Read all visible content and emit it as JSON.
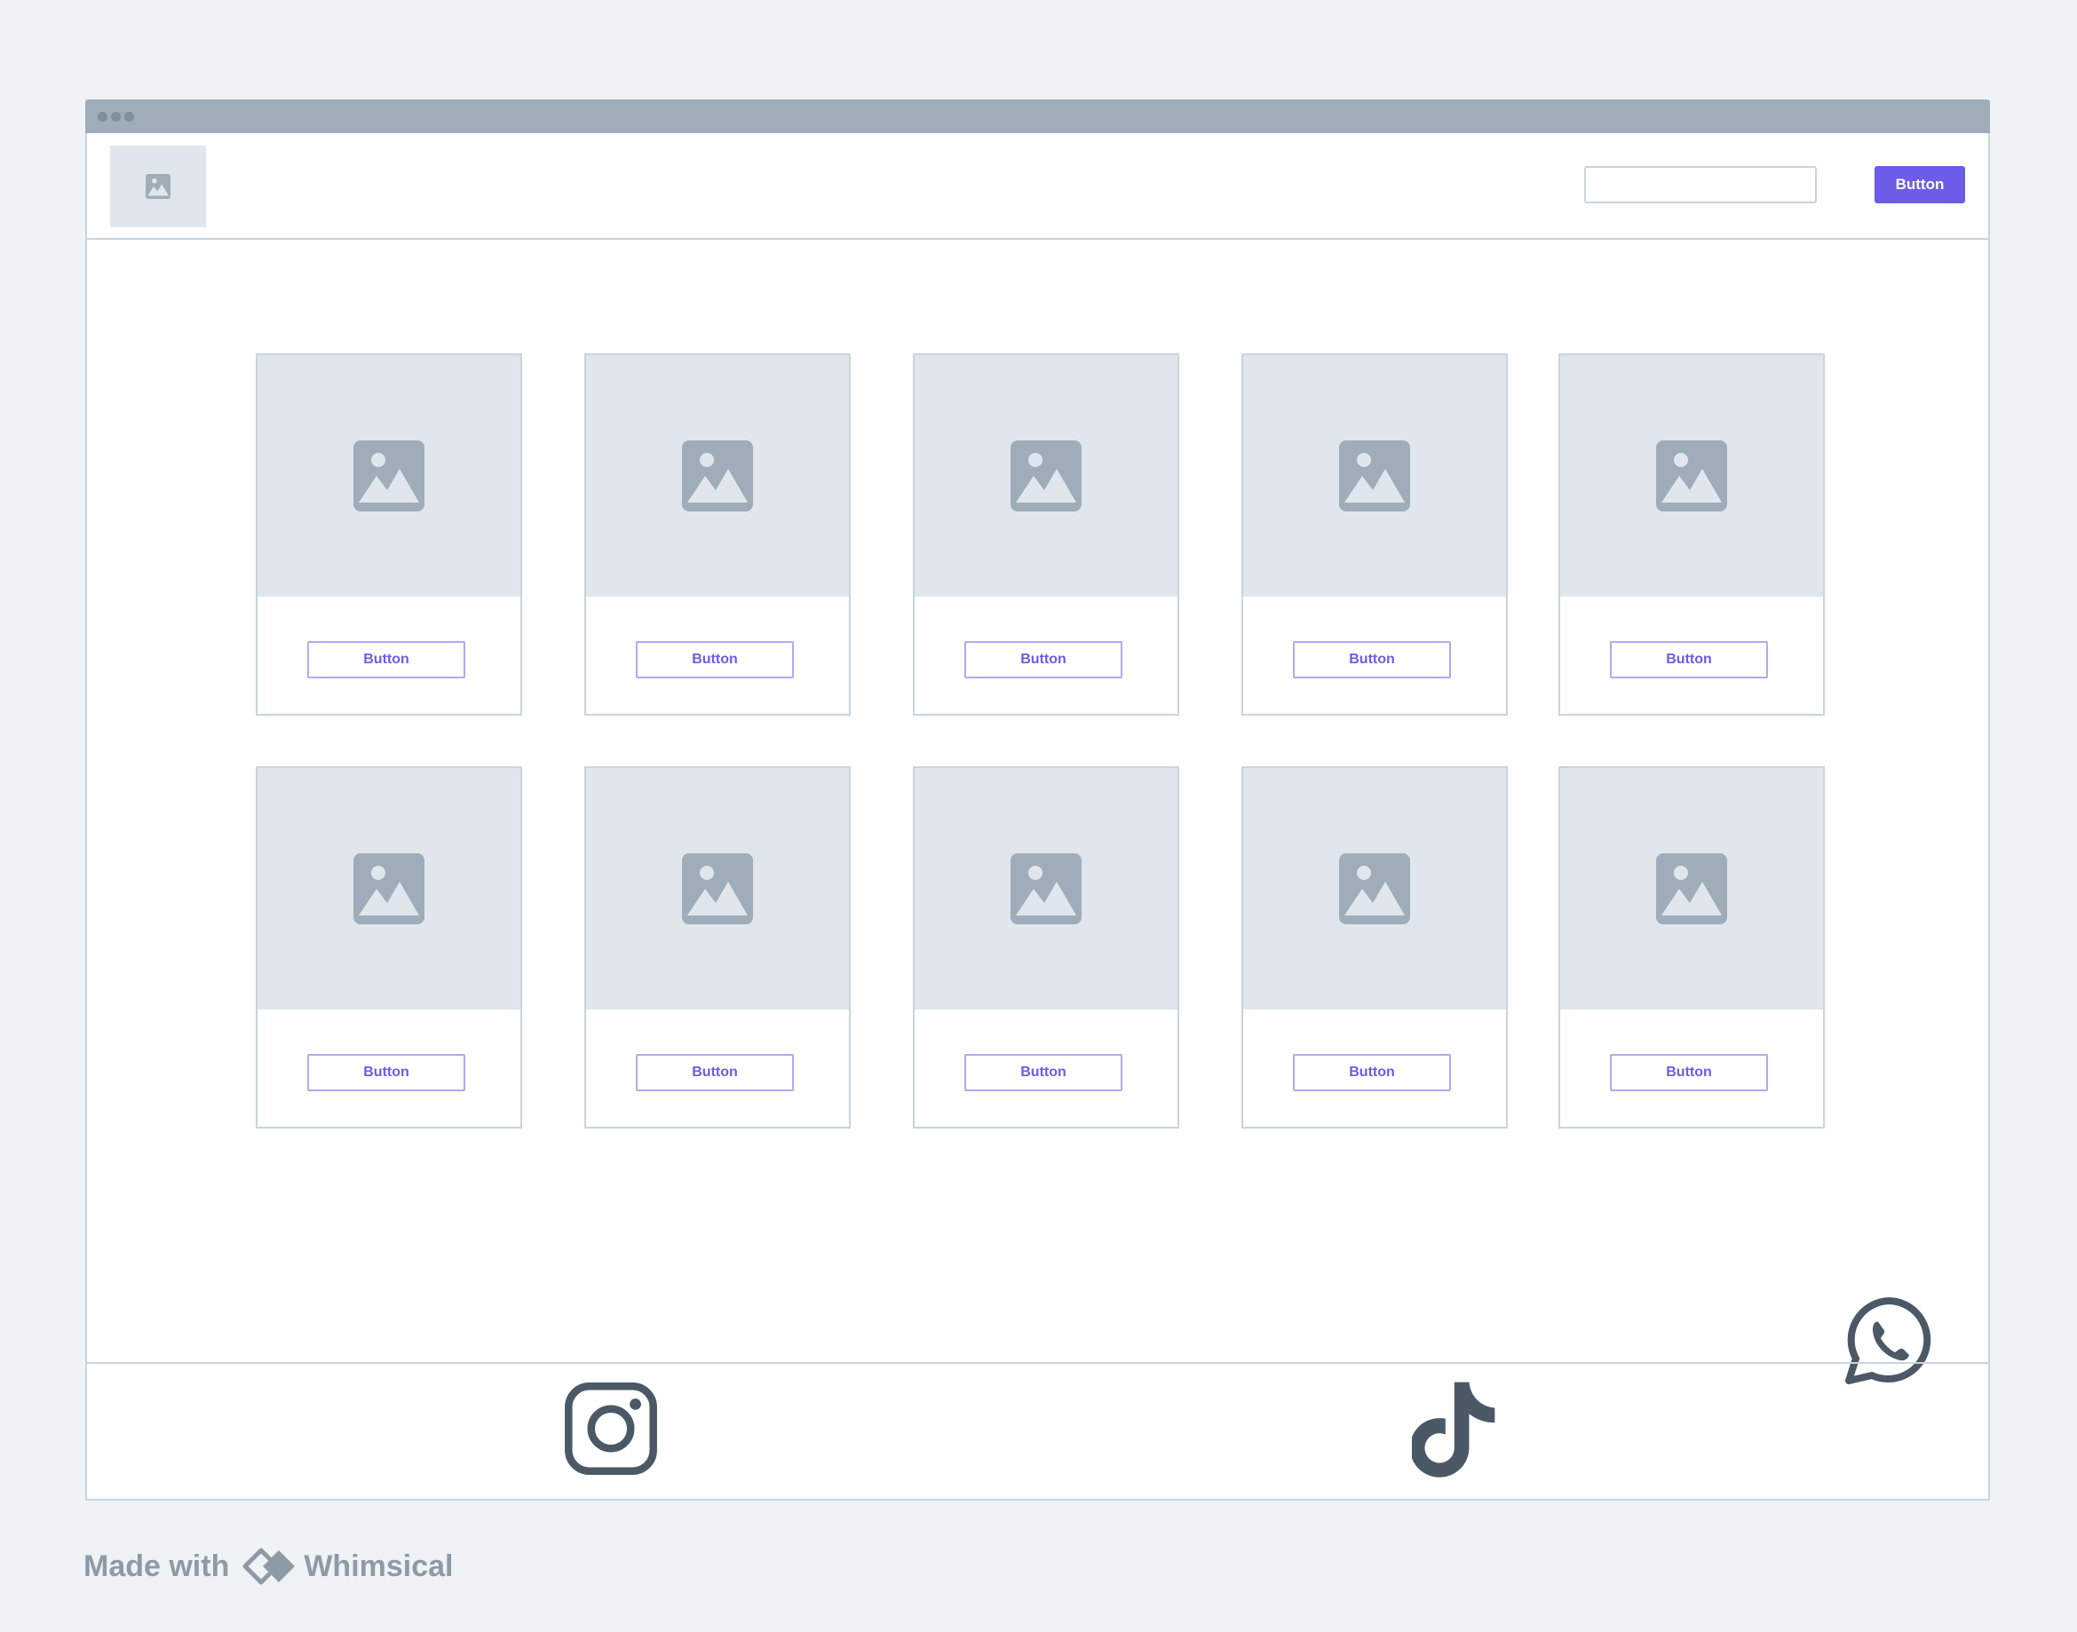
{
  "header": {
    "logo_icon": "image-placeholder-icon",
    "search": {
      "value": "",
      "placeholder": ""
    },
    "primary_button_label": "Button",
    "accent_color": "#6c5ce7"
  },
  "product_grid": {
    "rows": [
      {
        "cards": [
          {
            "image_icon": "image-placeholder-icon",
            "button_label": "Button"
          },
          {
            "image_icon": "image-placeholder-icon",
            "button_label": "Button"
          },
          {
            "image_icon": "image-placeholder-icon",
            "button_label": "Button"
          },
          {
            "image_icon": "image-placeholder-icon",
            "button_label": "Button"
          },
          {
            "image_icon": "image-placeholder-icon",
            "button_label": "Button"
          }
        ]
      },
      {
        "cards": [
          {
            "image_icon": "image-placeholder-icon",
            "button_label": "Button"
          },
          {
            "image_icon": "image-placeholder-icon",
            "button_label": "Button"
          },
          {
            "image_icon": "image-placeholder-icon",
            "button_label": "Button"
          },
          {
            "image_icon": "image-placeholder-icon",
            "button_label": "Button"
          },
          {
            "image_icon": "image-placeholder-icon",
            "button_label": "Button"
          }
        ]
      }
    ]
  },
  "floating_icon": "whatsapp-icon",
  "footer": {
    "social_icons": [
      "instagram-icon",
      "tiktok-icon"
    ]
  },
  "watermark": {
    "prefix": "Made with",
    "brand": "Whimsical"
  }
}
